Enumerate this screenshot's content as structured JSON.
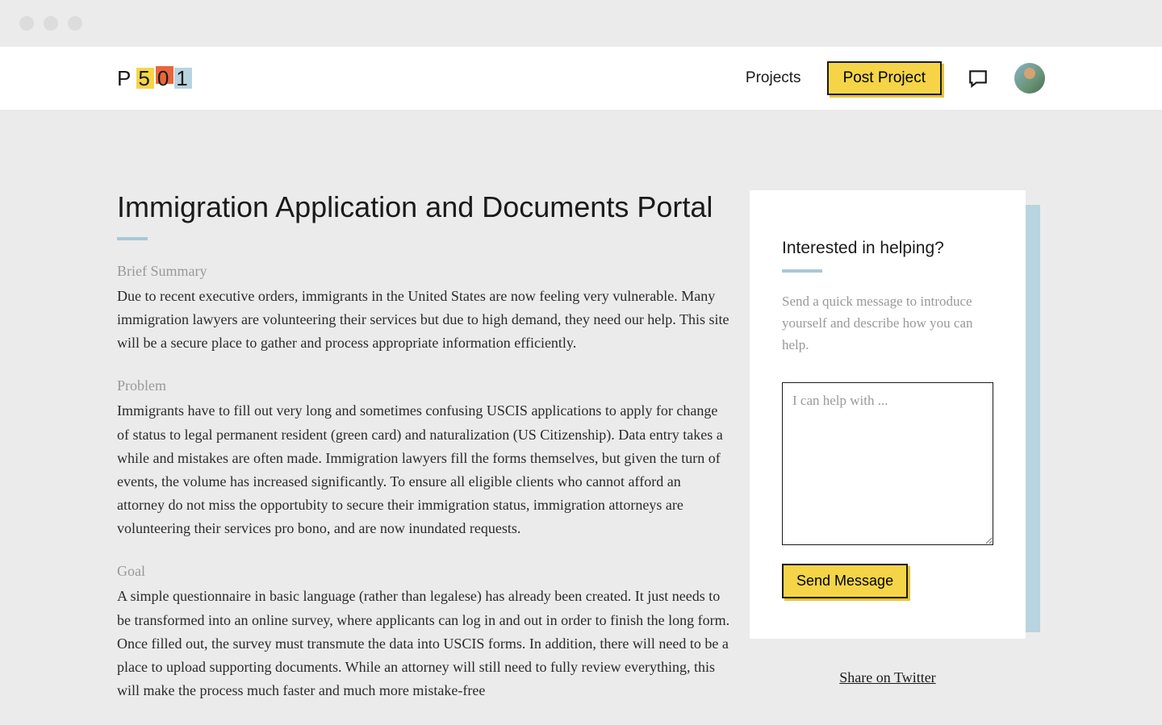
{
  "logo": {
    "chars": [
      "P",
      "5",
      "0",
      "1"
    ]
  },
  "nav": {
    "projects_label": "Projects",
    "post_project_label": "Post Project"
  },
  "page": {
    "title": "Immigration Application and Documents Portal",
    "sections": {
      "brief_summary": {
        "label": "Brief Summary",
        "text": "Due to recent executive orders, immigrants in the United States are now feeling very vulnerable. Many immigration lawyers are volunteering their services but due to high demand, they need our help. This site will be a secure place to gather and process appropriate information efficiently."
      },
      "problem": {
        "label": "Problem",
        "text": "Immigrants have to fill out very long and sometimes confusing USCIS applications to apply for change of status to legal permanent resident (green card) and naturalization (US Citizenship). Data entry takes a while and mistakes are often made. Immigration lawyers fill the forms themselves, but given the turn of events, the volume has increased significantly. To ensure all eligible clients who cannot afford an attorney do not miss the opportubity to secure their immigration status, immigration attorneys are volunteering their services pro bono, and are now inundated requests."
      },
      "goal": {
        "label": "Goal",
        "text": "A simple questionnaire in basic language (rather than legalese) has already been created. It just needs to be transformed into an online survey, where applicants can log in and out in order to finish the long form. Once filled out, the survey must transmute the data into USCIS forms. In addition, there will need to be a place to upload supporting documents. While an attorney will still need to fully review everything, this will make the process much faster and much more mistake-free"
      }
    }
  },
  "sidebar": {
    "title": "Interested in helping?",
    "description": "Send a quick message to introduce yourself and describe how you can help.",
    "textarea_placeholder": "I can help with ...",
    "send_button_label": "Send Message",
    "share_link_label": "Share on Twitter"
  }
}
